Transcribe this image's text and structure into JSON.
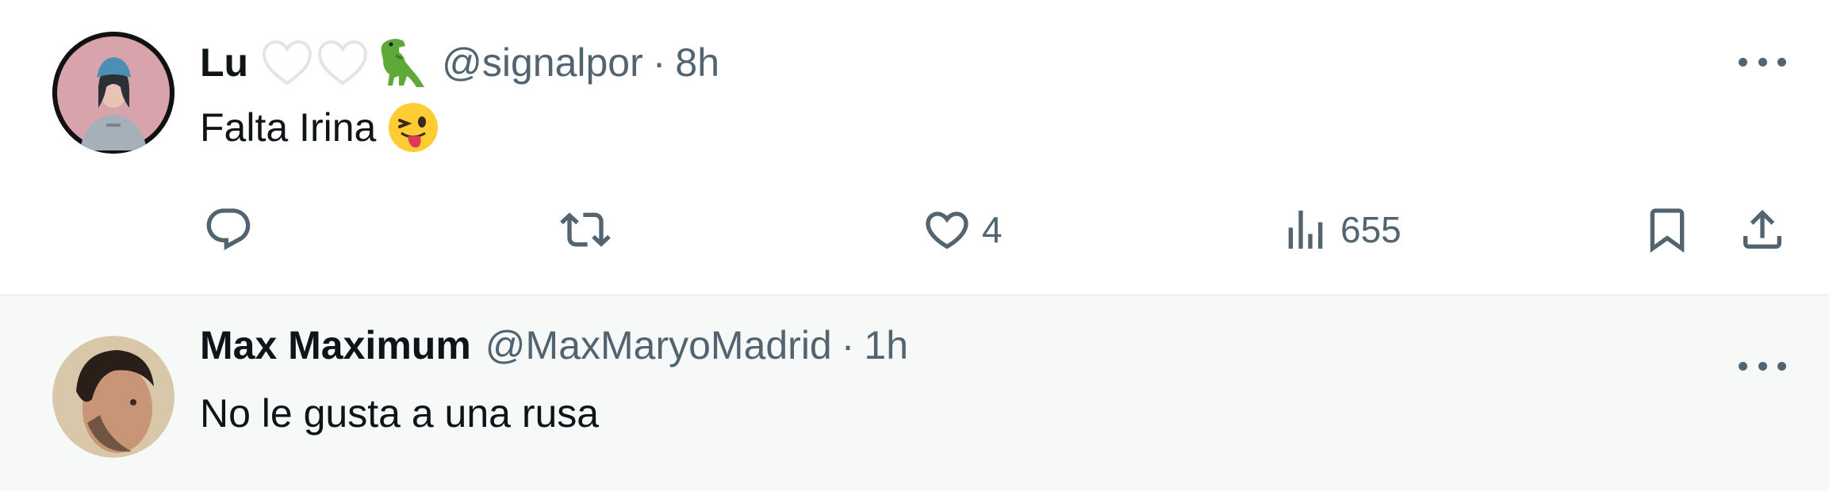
{
  "tweets": [
    {
      "name": "Lu",
      "handle": "@signalpor",
      "separator": "·",
      "time": "8h",
      "text": "Falta Irina",
      "text_emoji": "😜",
      "name_emojis": [
        "white-heart-icon",
        "white-heart-icon",
        "t-rex-icon"
      ],
      "actions": {
        "reply_count": "",
        "retweet_count": "",
        "like_count": "4",
        "views_count": "655"
      }
    },
    {
      "name": "Max Maximum",
      "handle": "@MaxMaryoMadrid",
      "separator": "·",
      "time": "1h",
      "text": "No le gusta a una rusa"
    }
  ],
  "colors": {
    "primary_text": "#0f1419",
    "secondary_text": "#536471",
    "divider": "#eff3f4",
    "hover_bg": "#f7f9f9"
  }
}
